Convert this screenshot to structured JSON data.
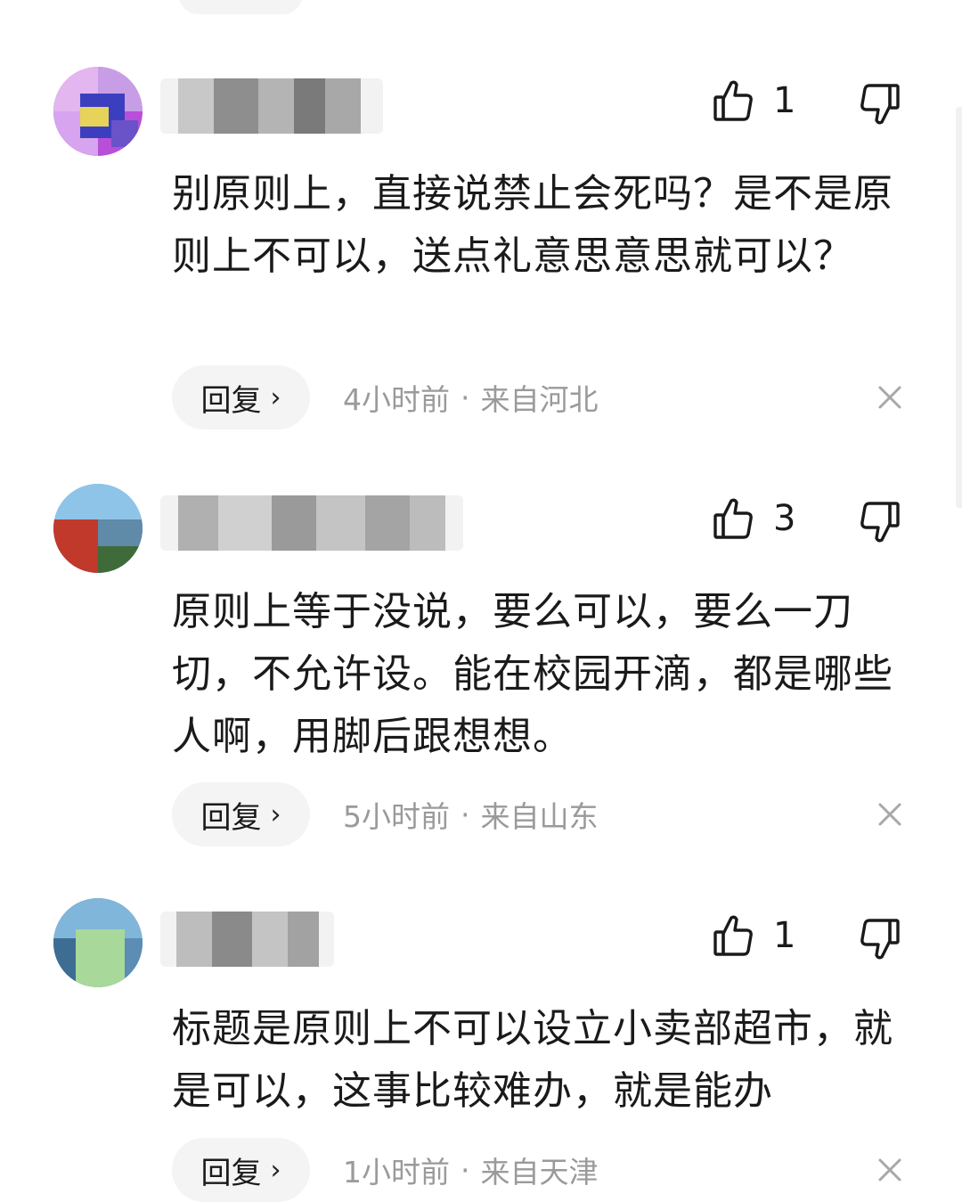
{
  "comments": [
    {
      "likes": "1",
      "text": "别原则上，直接说禁止会死吗？是不是原则上不可以，送点礼意思意思就可以？",
      "reply_label": "回复",
      "time": "4小时前",
      "location": "来自河北"
    },
    {
      "likes": "3",
      "text": "原则上等于没说，要么可以，要么一刀切，不允许设。能在校园开滴，都是哪些人啊，用脚后跟想想。",
      "reply_label": "回复",
      "time": "5小时前",
      "location": "来自山东"
    },
    {
      "likes": "1",
      "text": "标题是原则上不可以设立小卖部超市，就是可以，这事比较难办，就是能办",
      "reply_label": "回复",
      "time": "1小时前",
      "location": "来自天津"
    }
  ],
  "separator": "·",
  "icons": {
    "like": "thumbs-up-icon",
    "dislike": "thumbs-down-icon",
    "close": "close-icon",
    "chevron": "chevron-right-icon"
  },
  "colors": {
    "text": "#1a1a1a",
    "meta": "#9a9a9a",
    "pill_bg": "#f4f4f4"
  }
}
